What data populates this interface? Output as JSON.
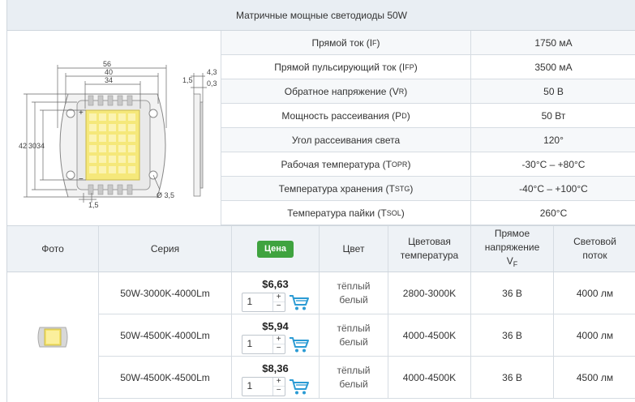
{
  "title": "Матричные мощные светодиоды 50W",
  "drawing": {
    "dims": [
      "56",
      "40",
      "34",
      "42",
      "30",
      "34",
      "4,3",
      "1,5",
      "0,3",
      "1,5",
      "Ø 3,5"
    ]
  },
  "specs": [
    {
      "param": "Прямой ток (I",
      "sub": "F",
      "tail": ")",
      "value": "1750 мА"
    },
    {
      "param": "Прямой пульсирующий ток (I",
      "sub": "FP",
      "tail": ")",
      "value": "3500 мА"
    },
    {
      "param": "Обратное напряжение (V",
      "sub": "R",
      "tail": ")",
      "value": "50 В"
    },
    {
      "param": "Мощность рассеивания (P",
      "sub": "D",
      "tail": ")",
      "value": "50 Вт"
    },
    {
      "param": "Угол рассеивания света",
      "sub": "",
      "tail": "",
      "value": "120°"
    },
    {
      "param": "Рабочая температура (T",
      "sub": "OPR",
      "tail": ")",
      "value": "-30°C – +80°C"
    },
    {
      "param": "Температура хранения (T",
      "sub": "STG",
      "tail": ")",
      "value": "-40°C – +100°C"
    },
    {
      "param": "Температура пайки (T",
      "sub": "SOL",
      "tail": ")",
      "value": "260°C"
    }
  ],
  "headers": {
    "photo": "Фото",
    "series": "Серия",
    "price": "Цена",
    "color": "Цвет",
    "temp_line1": "Цветовая",
    "temp_line2": "температура",
    "volt_line1": "Прямое",
    "volt_line2": "напряжение",
    "volt_line3": "V",
    "volt_sub": "F",
    "flux_line1": "Световой",
    "flux_line2": "поток"
  },
  "products": [
    {
      "series": "50W-3000K-4000Lm",
      "price": "$6,63",
      "qty": "1",
      "plus": "+",
      "minus": "−",
      "color1": "тёплый",
      "color2": "белый",
      "temp": "2800-3000K",
      "volt": "36 В",
      "flux": "4000 лм"
    },
    {
      "series": "50W-4500K-4000Lm",
      "price": "$5,94",
      "qty": "1",
      "plus": "+",
      "minus": "−",
      "color1": "тёплый",
      "color2": "белый",
      "temp": "4000-4500K",
      "volt": "36 В",
      "flux": "4000 лм"
    },
    {
      "series": "50W-4500K-4500Lm",
      "price": "$8,36",
      "qty": "1",
      "plus": "+",
      "minus": "−",
      "color1": "тёплый",
      "color2": "белый",
      "temp": "4000-4500K",
      "volt": "36 В",
      "flux": "4500 лм"
    }
  ],
  "icons": {
    "cart": "cart-icon",
    "led": "led-photo"
  },
  "colors": {
    "accent": "#3fa33f",
    "cart": "#2b9bd4",
    "header_bg": "#e9eef3"
  }
}
